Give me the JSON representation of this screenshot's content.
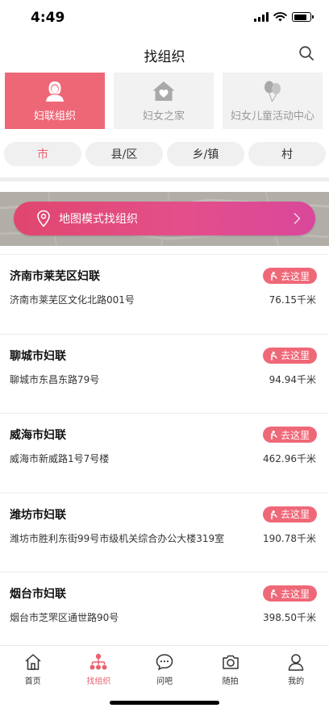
{
  "status_bar": {
    "time": "4:49"
  },
  "nav": {
    "title": "找组织",
    "search_icon": "search-icon"
  },
  "categories": [
    {
      "label": "妇联组织",
      "icon": "woman-avatar-icon",
      "active": true
    },
    {
      "label": "妇女之家",
      "icon": "home-heart-icon",
      "active": false
    },
    {
      "label": "妇女儿童活动中心",
      "icon": "balloon-icon",
      "active": false
    }
  ],
  "levels": [
    {
      "label": "市",
      "active": true
    },
    {
      "label": "县/区",
      "active": false
    },
    {
      "label": "乡/镇",
      "active": false
    },
    {
      "label": "村",
      "active": false
    }
  ],
  "map_banner": {
    "label": "地图模式找组织",
    "icon": "location-pin-icon"
  },
  "organizations": [
    {
      "name": "济南市莱芜区妇联",
      "address": "济南市莱芜区文化北路001号",
      "distance": "76.15千米",
      "go_label": "去这里"
    },
    {
      "name": "聊城市妇联",
      "address": "聊城市东昌东路79号",
      "distance": "94.94千米",
      "go_label": "去这里"
    },
    {
      "name": "威海市妇联",
      "address": "威海市新威路1号7号楼",
      "distance": "462.96千米",
      "go_label": "去这里"
    },
    {
      "name": "潍坊市妇联",
      "address": "潍坊市胜利东街99号市级机关综合办公大楼319室",
      "distance": "190.78千米",
      "go_label": "去这里"
    },
    {
      "name": "烟台市妇联",
      "address": "烟台市芝罘区通世路90号",
      "distance": "398.50千米",
      "go_label": "去这里"
    }
  ],
  "tabbar": [
    {
      "label": "首页",
      "icon": "home-icon",
      "active": false
    },
    {
      "label": "找组织",
      "icon": "org-tree-icon",
      "active": true
    },
    {
      "label": "问吧",
      "icon": "chat-bubble-icon",
      "active": false
    },
    {
      "label": "随拍",
      "icon": "camera-icon",
      "active": false
    },
    {
      "label": "我的",
      "icon": "user-icon",
      "active": false
    }
  ],
  "colors": {
    "accent": "#ee6776",
    "tile_bg": "#f2f2f2",
    "tab_inactive": "#333333"
  }
}
